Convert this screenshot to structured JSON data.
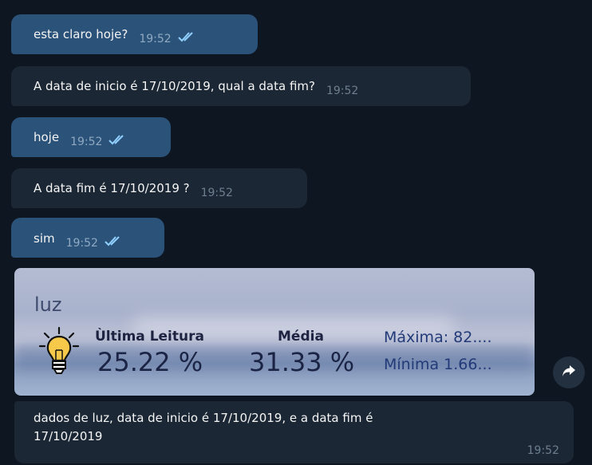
{
  "messages": [
    {
      "text": "esta claro hoje?",
      "time": "19:52",
      "direction": "out",
      "status": "read"
    },
    {
      "text": "A data de inicio é  17/10/2019, qual a data fim?",
      "time": "19:52",
      "direction": "in"
    },
    {
      "text": "hoje",
      "time": "19:52",
      "direction": "out",
      "status": "read"
    },
    {
      "text": "A data  fim é 17/10/2019 ?",
      "time": "19:52",
      "direction": "in"
    },
    {
      "text": "sim",
      "time": "19:52",
      "direction": "out",
      "status": "read"
    }
  ],
  "card": {
    "title": "luz",
    "last_label": "Ùltima Leitura",
    "last_value": "25.22 %",
    "avg_label": "Média",
    "avg_value": "31.33 %",
    "max_text": "Máxima: 82....",
    "min_text": "Mínima 1.66...",
    "icon": "lightbulb-icon"
  },
  "caption": {
    "line1": "dados de luz,  data de inicio é  17/10/2019, e a data fim é",
    "line2": "17/10/2019",
    "time": "19:52"
  },
  "colors": {
    "background": "#0e1621",
    "outgoing_bubble": "#2b5278",
    "incoming_bubble": "#1b2734"
  }
}
